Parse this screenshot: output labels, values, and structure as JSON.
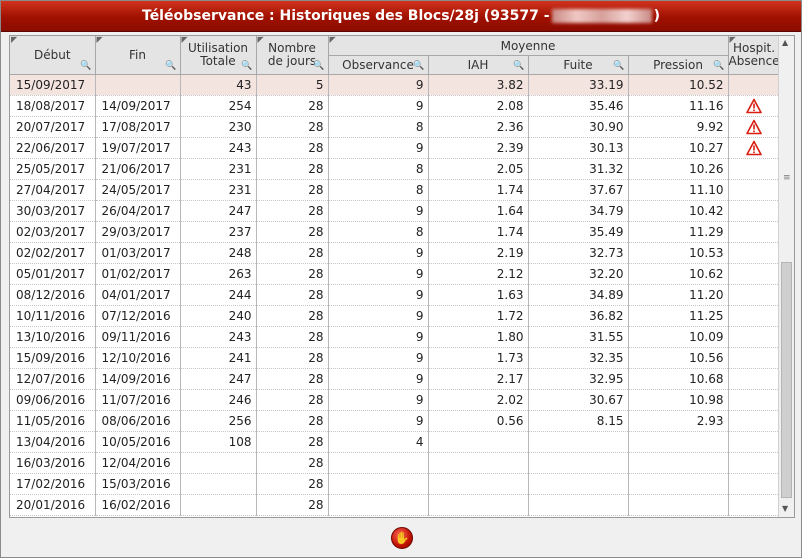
{
  "window": {
    "title_prefix": "Téléobservance : Historiques des Blocs/28j (93577 - ",
    "title_suffix": ")",
    "redacted_text": "██████"
  },
  "columns": {
    "debut": "Début",
    "fin": "Fin",
    "utilisation_line1": "Utilisation",
    "utilisation_line2": "Totale",
    "nombre_line1": "Nombre",
    "nombre_line2": "de jours",
    "moyenne_group": "Moyenne",
    "observance": "Observance",
    "iah": "IAH",
    "fuite": "Fuite",
    "pression": "Pression",
    "hospit_line1": "Hospit.",
    "hospit_line2": "Absence"
  },
  "icons": {
    "warning_color": "#d81e10",
    "filter": "🔍",
    "stop": "✋"
  },
  "rows": [
    {
      "debut": "15/09/2017",
      "fin": "",
      "utilisation": "43",
      "jours": "5",
      "observance": "9",
      "iah": "3.82",
      "fuite": "33.19",
      "pression": "10.52",
      "warn": false
    },
    {
      "debut": "18/08/2017",
      "fin": "14/09/2017",
      "utilisation": "254",
      "jours": "28",
      "observance": "9",
      "iah": "2.08",
      "fuite": "35.46",
      "pression": "11.16",
      "warn": true
    },
    {
      "debut": "20/07/2017",
      "fin": "17/08/2017",
      "utilisation": "230",
      "jours": "28",
      "observance": "8",
      "iah": "2.36",
      "fuite": "30.90",
      "pression": "9.92",
      "warn": true
    },
    {
      "debut": "22/06/2017",
      "fin": "19/07/2017",
      "utilisation": "243",
      "jours": "28",
      "observance": "9",
      "iah": "2.39",
      "fuite": "30.13",
      "pression": "10.27",
      "warn": true
    },
    {
      "debut": "25/05/2017",
      "fin": "21/06/2017",
      "utilisation": "231",
      "jours": "28",
      "observance": "8",
      "iah": "2.05",
      "fuite": "31.32",
      "pression": "10.26",
      "warn": false
    },
    {
      "debut": "27/04/2017",
      "fin": "24/05/2017",
      "utilisation": "231",
      "jours": "28",
      "observance": "8",
      "iah": "1.74",
      "fuite": "37.67",
      "pression": "11.10",
      "warn": false
    },
    {
      "debut": "30/03/2017",
      "fin": "26/04/2017",
      "utilisation": "247",
      "jours": "28",
      "observance": "9",
      "iah": "1.64",
      "fuite": "34.79",
      "pression": "10.42",
      "warn": false
    },
    {
      "debut": "02/03/2017",
      "fin": "29/03/2017",
      "utilisation": "237",
      "jours": "28",
      "observance": "8",
      "iah": "1.74",
      "fuite": "35.49",
      "pression": "11.29",
      "warn": false
    },
    {
      "debut": "02/02/2017",
      "fin": "01/03/2017",
      "utilisation": "248",
      "jours": "28",
      "observance": "9",
      "iah": "2.19",
      "fuite": "32.73",
      "pression": "10.53",
      "warn": false
    },
    {
      "debut": "05/01/2017",
      "fin": "01/02/2017",
      "utilisation": "263",
      "jours": "28",
      "observance": "9",
      "iah": "2.12",
      "fuite": "32.20",
      "pression": "10.62",
      "warn": false
    },
    {
      "debut": "08/12/2016",
      "fin": "04/01/2017",
      "utilisation": "244",
      "jours": "28",
      "observance": "9",
      "iah": "1.63",
      "fuite": "34.89",
      "pression": "11.20",
      "warn": false
    },
    {
      "debut": "10/11/2016",
      "fin": "07/12/2016",
      "utilisation": "240",
      "jours": "28",
      "observance": "9",
      "iah": "1.72",
      "fuite": "36.82",
      "pression": "11.25",
      "warn": false
    },
    {
      "debut": "13/10/2016",
      "fin": "09/11/2016",
      "utilisation": "243",
      "jours": "28",
      "observance": "9",
      "iah": "1.80",
      "fuite": "31.55",
      "pression": "10.09",
      "warn": false
    },
    {
      "debut": "15/09/2016",
      "fin": "12/10/2016",
      "utilisation": "241",
      "jours": "28",
      "observance": "9",
      "iah": "1.73",
      "fuite": "32.35",
      "pression": "10.56",
      "warn": false
    },
    {
      "debut": "12/07/2016",
      "fin": "14/09/2016",
      "utilisation": "247",
      "jours": "28",
      "observance": "9",
      "iah": "2.17",
      "fuite": "32.95",
      "pression": "10.68",
      "warn": false
    },
    {
      "debut": "09/06/2016",
      "fin": "11/07/2016",
      "utilisation": "246",
      "jours": "28",
      "observance": "9",
      "iah": "2.02",
      "fuite": "30.67",
      "pression": "10.98",
      "warn": false
    },
    {
      "debut": "11/05/2016",
      "fin": "08/06/2016",
      "utilisation": "256",
      "jours": "28",
      "observance": "9",
      "iah": "0.56",
      "fuite": "8.15",
      "pression": "2.93",
      "warn": false
    },
    {
      "debut": "13/04/2016",
      "fin": "10/05/2016",
      "utilisation": "108",
      "jours": "28",
      "observance": "4",
      "iah": "",
      "fuite": "",
      "pression": "",
      "warn": false
    },
    {
      "debut": "16/03/2016",
      "fin": "12/04/2016",
      "utilisation": "",
      "jours": "28",
      "observance": "",
      "iah": "",
      "fuite": "",
      "pression": "",
      "warn": false
    },
    {
      "debut": "17/02/2016",
      "fin": "15/03/2016",
      "utilisation": "",
      "jours": "28",
      "observance": "",
      "iah": "",
      "fuite": "",
      "pression": "",
      "warn": false
    },
    {
      "debut": "20/01/2016",
      "fin": "16/02/2016",
      "utilisation": "",
      "jours": "28",
      "observance": "",
      "iah": "",
      "fuite": "",
      "pression": "",
      "warn": false
    }
  ]
}
